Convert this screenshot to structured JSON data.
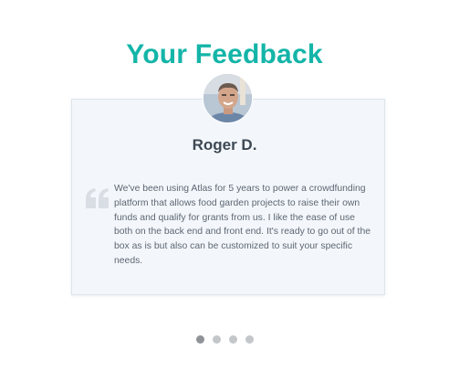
{
  "section": {
    "title": "Your Feedback"
  },
  "testimonial": {
    "name": "Roger D.",
    "quote": "We've been using Atlas for 5 years to power a crowdfunding platform that allows food garden projects to raise their own funds and qualify for grants from us. I like the ease of use both on the back end and front end. It's ready to go out of the box as is but also can be customized to suit your specific needs.",
    "avatar_icon": "person-photo",
    "quote_icon": "quote-mark-icon"
  },
  "carousel": {
    "slide_count": 4,
    "active_index": 0
  },
  "colors": {
    "title": "#14b5a8",
    "card_background": "#f3f7fc",
    "dot_active": "#8f9296",
    "dot_inactive": "#c4c7ca"
  }
}
